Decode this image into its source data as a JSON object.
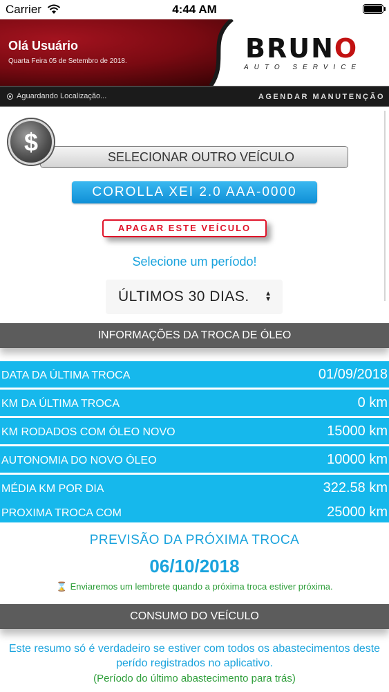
{
  "status_bar": {
    "carrier": "Carrier",
    "time": "4:44 AM",
    "battery_level": 1.0
  },
  "header": {
    "greeting": "Olá Usuário",
    "date": "Quarta Feira 05 de Setembro de 2018.",
    "logo": {
      "title_pre": "BRUN",
      "title_accent": "O",
      "subtitle": "AUTO SERVICE"
    },
    "location_status": "Aguardando Localização...",
    "schedule_link": "AGENDAR MANUTENÇÃO"
  },
  "vehicle": {
    "select_other_label": "SELECIONAR OUTRO VEÍCULO",
    "current": "COROLLA XEI 2.0 AAA-0000",
    "delete_label": "APAGAR ESTE VEÍCULO"
  },
  "period": {
    "prompt": "Selecione um período!",
    "selected": "ÚLTIMOS 30 DIAS."
  },
  "oil_change": {
    "section_title": "INFORMAÇÕES DA TROCA DE ÓLEO",
    "rows": [
      {
        "label": "DATA DA ÚLTIMA TROCA",
        "value": "01/09/2018"
      },
      {
        "label": "KM DA ÚLTIMA TROCA",
        "value": "0 km"
      },
      {
        "label": "KM RODADOS COM ÓLEO NOVO",
        "value": "15000 km"
      },
      {
        "label": "AUTONOMIA DO NOVO ÓLEO",
        "value": "10000 km"
      },
      {
        "label": "MÉDIA KM POR DIA",
        "value": "322.58 km"
      },
      {
        "label": "PROXIMA TROCA COM",
        "value": "25000 km"
      }
    ],
    "forecast_title": "PREVISÃO DA PRÓXIMA TROCA",
    "forecast_date": "06/10/2018",
    "reminder": "Enviaremos um lembrete quando a próxima troca estiver próxima."
  },
  "consumption": {
    "section_title": "CONSUMO DO VEÍCULO",
    "note": "Este resumo só é verdadeiro se estiver com todos os abastecimentos deste perído registrados no aplicativo.",
    "sub_note": "(Período do último abastecimento para trás)"
  },
  "colors": {
    "accent_blue": "#16b8ec",
    "danger_red": "#e0142a",
    "section_gray": "#5c5c5c",
    "reminder_green": "#2e9e3a"
  },
  "icons": [
    "wifi-icon",
    "battery-icon",
    "location-icon",
    "dollar-icon",
    "select-arrows-icon",
    "hourglass-icon"
  ]
}
